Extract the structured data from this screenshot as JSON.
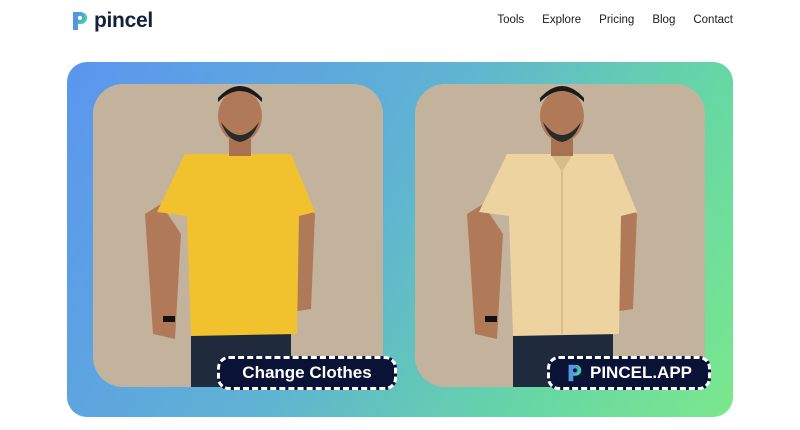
{
  "brand": {
    "name": "pincel"
  },
  "nav": {
    "items": [
      "Tools",
      "Explore",
      "Pricing",
      "Blog",
      "Contact"
    ]
  },
  "hero": {
    "before_tag": "Change Clothes",
    "after_tag": "PINCEL.APP"
  },
  "colors": {
    "brand_dark": "#0a1236",
    "gradient_start": "#5b95ef",
    "gradient_end": "#7be88c",
    "before_shirt": "#f2c12e",
    "after_shirt": "#ecd3a0"
  },
  "icons": {
    "logo": "pincel-logo-icon"
  }
}
